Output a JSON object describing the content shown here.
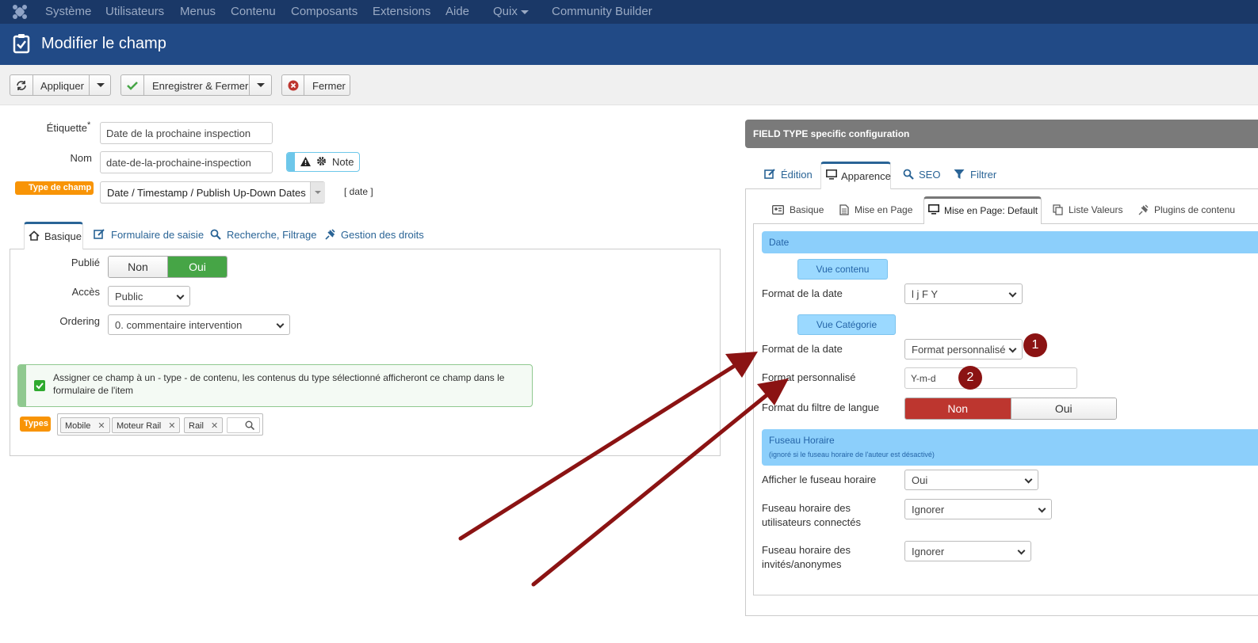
{
  "topnav": {
    "items": [
      "Système",
      "Utilisateurs",
      "Menus",
      "Contenu",
      "Composants",
      "Extensions",
      "Aide",
      "Quix",
      "Community Builder"
    ]
  },
  "header": {
    "title": "Modifier le champ"
  },
  "toolbar": {
    "apply_label": "Appliquer",
    "save_close_label": "Enregistrer & Fermer",
    "close_label": "Fermer"
  },
  "form": {
    "label_etiquette": "Étiquette",
    "required_mark": "*",
    "etiquette_value": "Date de la prochaine inspection",
    "label_nom": "Nom",
    "nom_value": "date-de-la-prochaine-inspection",
    "note_label": "Note",
    "type_badge": "Type de champ",
    "type_value": "Date / Timestamp / Publish Up-Down Dates",
    "type_code": "[ date ]"
  },
  "left_tabs": [
    "Basique",
    "Formulaire de saisie",
    "Recherche, Filtrage",
    "Gestion des droits"
  ],
  "basic": {
    "label_publie": "Publié",
    "publie_options": [
      "Non",
      "Oui"
    ],
    "label_acces": "Accès",
    "acces_value": "Public",
    "label_ordering": "Ordering",
    "ordering_value": "0. commentaire intervention",
    "assign_text_1": "Assigner ce champ à un - type - de contenu, les contenus du type sélectionné afficheront ce champ dans le",
    "assign_text_2": "formulaire de l'item",
    "types_badge": "Types",
    "types": [
      "Mobile",
      "Moteur Rail",
      "Rail"
    ]
  },
  "right_panel": {
    "header": "FIELD TYPE specific configuration",
    "tabs": [
      "Édition",
      "Apparence",
      "SEO",
      "Filtrer"
    ],
    "subtabs": [
      "Basique",
      "Mise en Page",
      "Mise en Page: Default",
      "Liste Valeurs",
      "Plugins de contenu"
    ],
    "date_section": "Date",
    "vue_contenu": "Vue contenu",
    "label_format_date_1": "Format de la date",
    "format_date_1_value": "l j F Y",
    "vue_categorie": "Vue Catégorie",
    "label_format_date_2": "Format de la date",
    "format_date_2_value": "Format personnalisé",
    "label_format_perso": "Format personnalisé",
    "format_perso_value": "Y-m-d",
    "label_filtre_langue": "Format du filtre de langue",
    "filtre_options": [
      "Non",
      "Oui"
    ],
    "tz_section": "Fuseau Horaire",
    "tz_note": "(ignoré si le fuseau horaire de l'auteur est désactivé)",
    "label_afficher_tz": "Afficher le fuseau horaire",
    "afficher_tz_value": "Oui",
    "label_tz_users_1": "Fuseau horaire des",
    "label_tz_users_2": "utilisateurs connectés",
    "tz_users_value": "Ignorer",
    "label_tz_guests_1": "Fuseau horaire des",
    "label_tz_guests_2": "invités/anonymes",
    "tz_guests_value": "Ignorer"
  },
  "annotations": {
    "marker_1": "1",
    "marker_2": "2"
  },
  "colors": {
    "nav": "#1a3867",
    "header": "#214a86",
    "success": "#46a546",
    "danger": "#bd362f",
    "arrow": "#8b1313"
  }
}
